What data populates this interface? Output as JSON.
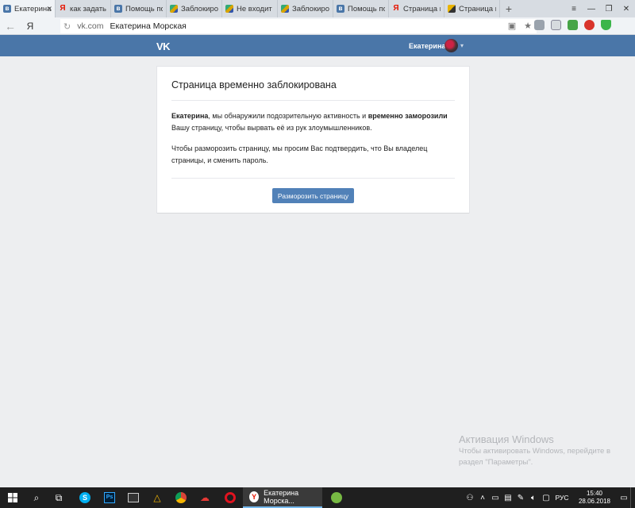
{
  "browser": {
    "tabs": [
      {
        "label": "Екатерина",
        "favicon": "vk",
        "active": true,
        "closable": true
      },
      {
        "label": "как задать в",
        "favicon": "yandex",
        "active": false
      },
      {
        "label": "Помощь по",
        "favicon": "vk",
        "active": false
      },
      {
        "label": "Заблокиров",
        "favicon": "image",
        "active": false
      },
      {
        "label": "Не входит В",
        "favicon": "image",
        "active": false
      },
      {
        "label": "Заблокиров",
        "favicon": "image",
        "active": false
      },
      {
        "label": "Помощь по",
        "favicon": "vk",
        "active": false
      },
      {
        "label": "Страница вр",
        "favicon": "yandex",
        "active": false
      },
      {
        "label": "Страница вр",
        "favicon": "image2",
        "active": false
      }
    ],
    "new_tab_label": "+",
    "address": {
      "yandex_label": "Я",
      "domain": "vk.com",
      "page_title": "Екатерина Морская"
    }
  },
  "vk": {
    "logo": "VK",
    "user_name": "Екатерина",
    "accent_color": "#4a76a8"
  },
  "card": {
    "title": "Страница временно заблокирована",
    "para1": {
      "name": "Екатерина",
      "text_a": ", мы обнаружили подозрительную активность и ",
      "bold": "временно заморозили",
      "text_b": " Вашу страницу, чтобы вырвать её из рук злоумышленников."
    },
    "para2": "Чтобы разморозить страницу, мы просим Вас подтвердить, что Вы владелец страницы, и сменить пароль.",
    "button_label": "Разморозить страницу",
    "button_color": "#5181b8"
  },
  "watermark": {
    "title": "Активация Windows",
    "line1": "Чтобы активировать Windows, перейдите в",
    "line2": "раздел \"Параметры\"."
  },
  "taskbar": {
    "active_app_label": "Екатерина Морска...",
    "language": "РУС",
    "time": "15:40",
    "date": "28.06.2018"
  }
}
